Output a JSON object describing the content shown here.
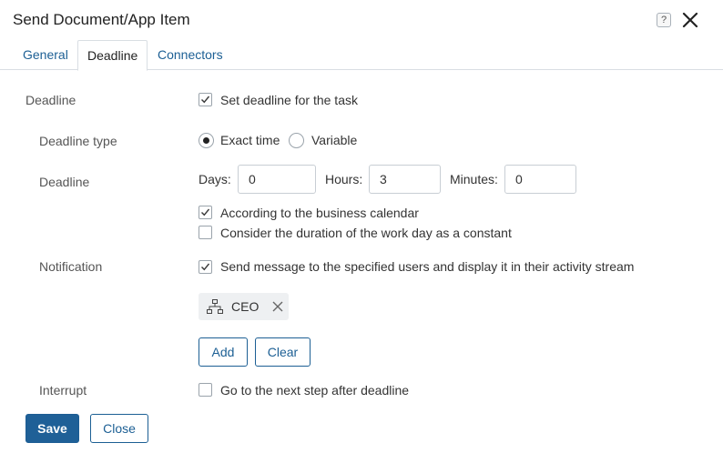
{
  "dialog": {
    "title": "Send Document/App Item",
    "help_glyph": "?"
  },
  "tabs": [
    {
      "label": "General",
      "active": false
    },
    {
      "label": "Deadline",
      "active": true
    },
    {
      "label": "Connectors",
      "active": false
    }
  ],
  "deadline": {
    "label": "Deadline",
    "set_deadline": {
      "label": "Set deadline for the task",
      "checked": true
    }
  },
  "deadline_type": {
    "label": "Deadline type",
    "options": [
      {
        "label": "Exact time",
        "selected": true
      },
      {
        "label": "Variable",
        "selected": false
      }
    ]
  },
  "deadline_time": {
    "label": "Deadline",
    "days_label": "Days:",
    "days_value": "0",
    "hours_label": "Hours:",
    "hours_value": "3",
    "minutes_label": "Minutes:",
    "minutes_value": "0",
    "business_calendar": {
      "label": "According to the business calendar",
      "checked": true
    },
    "workday_constant": {
      "label": "Consider the duration of the work day as a constant",
      "checked": false
    }
  },
  "notification": {
    "label": "Notification",
    "send_message": {
      "label": "Send message to the specified users and display it in their activity stream",
      "checked": true
    },
    "recipients": [
      {
        "label": "CEO",
        "icon": "org-chart-icon"
      }
    ],
    "add_label": "Add",
    "clear_label": "Clear"
  },
  "interrupt": {
    "label": "Interrupt",
    "next_step": {
      "label": "Go to the next step after deadline",
      "checked": false
    }
  },
  "footer": {
    "save_label": "Save",
    "close_label": "Close"
  },
  "colors": {
    "accent": "#1f6097",
    "link": "#1c5f94",
    "border": "#d9dee3"
  }
}
